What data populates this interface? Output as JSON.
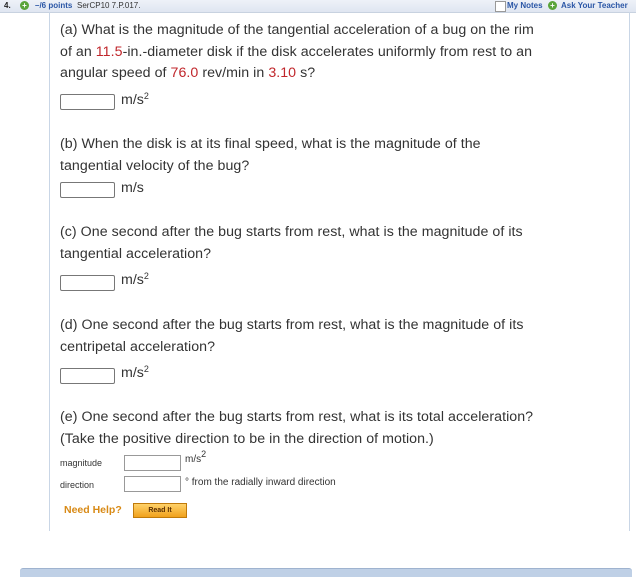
{
  "header": {
    "question_number": "4.",
    "points": "–/6 points",
    "problem_code": "SerCP10 7.P.017.",
    "my_notes": "My Notes",
    "ask_teacher": "Ask Your Teacher"
  },
  "part_a": {
    "t1": "(a) What is the magnitude of the tangential acceleration of a bug on the rim",
    "t2a": "of an ",
    "diameter": "11.5",
    "t2b": "-in.-diameter disk if the disk accelerates uniformly from rest to an",
    "t3a": "angular speed of ",
    "speed": "76.0",
    "t3b": " rev/min in ",
    "time": "3.10",
    "t3c": " s?",
    "unit": "m/s",
    "unit_sup": "2"
  },
  "part_b": {
    "t1": "(b) When the disk is at its final speed, what is the magnitude of the",
    "t2": "tangential velocity of the bug?",
    "unit": "m/s"
  },
  "part_c": {
    "t1": "(c) One second after the bug starts from rest, what is the magnitude of its",
    "t2": "tangential acceleration?",
    "unit": "m/s",
    "unit_sup": "2"
  },
  "part_d": {
    "t1": "(d) One second after the bug starts from rest, what is the magnitude of its",
    "t2": "centripetal acceleration?",
    "unit": "m/s",
    "unit_sup": "2"
  },
  "part_e": {
    "t1": "(e) One second after the bug starts from rest, what is its total acceleration?",
    "t2": "(Take the positive direction to be in the direction of motion.)",
    "magnitude_label": "magnitude",
    "magnitude_unit": "m/s",
    "magnitude_unit_sup": "2",
    "direction_label": "direction",
    "direction_unit": "° from the radially inward direction"
  },
  "help": {
    "need_help": "Need Help?",
    "read_it": "Read It"
  },
  "colors": {
    "accent_blue": "#2a56a6",
    "given_value_red": "#c0262b",
    "help_orange": "#d88a16"
  }
}
